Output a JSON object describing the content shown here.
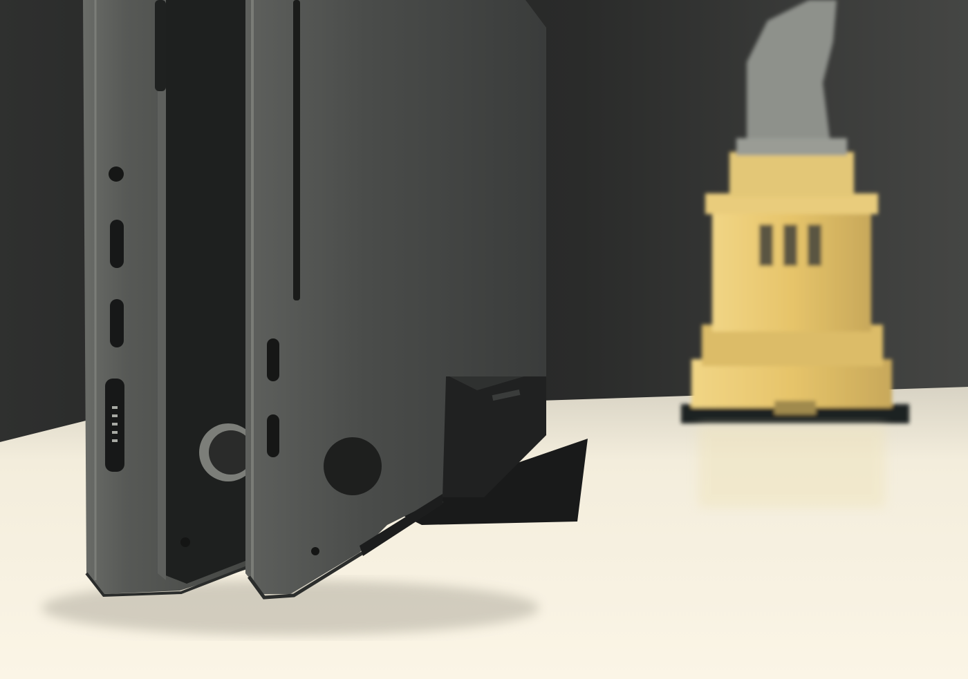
{
  "image": {
    "subject": "two-laptops-in-vertical-stand",
    "colors": {
      "wall_dark": "#1d1e1e",
      "wall_mid": "#3c3d3b",
      "desk_light": "#f6f0e0",
      "desk_shadow": "#b9b4a6",
      "laptop_body": "#4b4d4b",
      "laptop_edge": "#6e706c",
      "laptop_dark": "#202221",
      "stand": "#1a1b1b",
      "statue_yellow": "#e8c86e",
      "statue_shadow": "#b39754",
      "statue_top": "#8d908a"
    },
    "icons": [
      "left-laptop-icon",
      "right-laptop-icon",
      "headphone-jack-icon",
      "usb-c-port-icon",
      "magsafe-port-icon",
      "laptop-foot-icon",
      "screw-icon",
      "vertical-stand-icon",
      "statue-model-icon"
    ]
  }
}
